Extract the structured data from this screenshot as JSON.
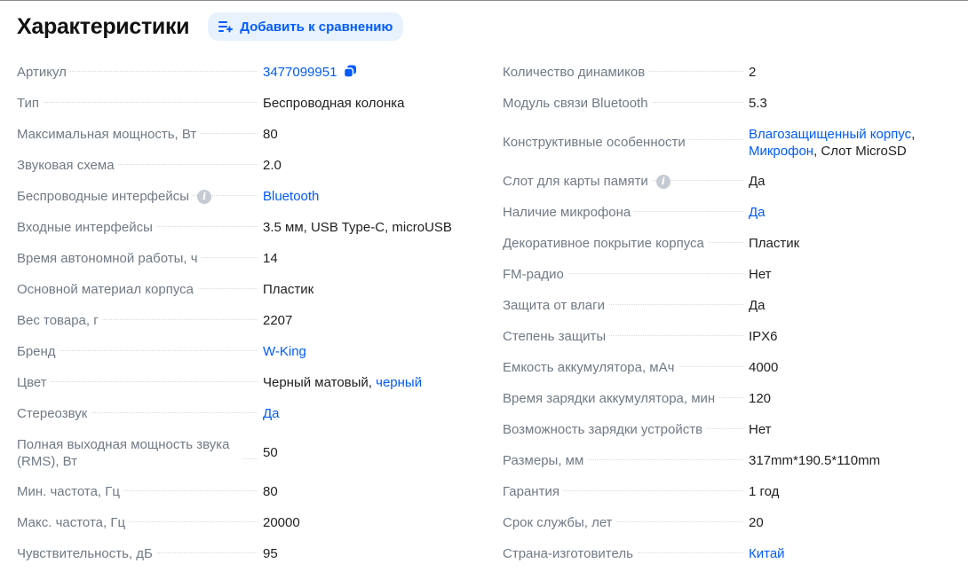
{
  "header": {
    "title": "Характеристики",
    "compare_label": "Добавить к сравнению"
  },
  "colors": {
    "accent": "#005bff",
    "label": "#707a85",
    "button_bg": "#e8f2fd"
  },
  "left": [
    {
      "label": "Артикул",
      "parts": [
        {
          "text": "3477099951",
          "link": true
        }
      ],
      "copy": true
    },
    {
      "label": "Тип",
      "parts": [
        {
          "text": "Беспроводная колонка"
        }
      ]
    },
    {
      "label": "Максимальная мощность, Вт",
      "parts": [
        {
          "text": "80"
        }
      ]
    },
    {
      "label": "Звуковая схема",
      "parts": [
        {
          "text": "2.0"
        }
      ]
    },
    {
      "label": "Беспроводные интерфейсы",
      "info": true,
      "parts": [
        {
          "text": "Bluetooth",
          "link": true
        }
      ]
    },
    {
      "label": "Входные интерфейсы",
      "parts": [
        {
          "text": "3.5 мм, USB Type-C, microUSB"
        }
      ]
    },
    {
      "label": "Время автономной работы, ч",
      "parts": [
        {
          "text": "14"
        }
      ]
    },
    {
      "label": "Основной материал корпуса",
      "parts": [
        {
          "text": "Пластик"
        }
      ]
    },
    {
      "label": "Вес товара, г",
      "parts": [
        {
          "text": "2207"
        }
      ]
    },
    {
      "label": "Бренд",
      "parts": [
        {
          "text": "W-King",
          "link": true
        }
      ]
    },
    {
      "label": "Цвет",
      "parts": [
        {
          "text": "Черный матовый, "
        },
        {
          "text": "черный",
          "link": true
        }
      ]
    },
    {
      "label": "Стереозвук",
      "parts": [
        {
          "text": "Да",
          "link": true
        }
      ]
    },
    {
      "label": "Полная выходная мощность звука (RMS), Вт",
      "tall": true,
      "parts": [
        {
          "text": "50"
        }
      ]
    },
    {
      "label": "Мин. частота, Гц",
      "parts": [
        {
          "text": "80"
        }
      ]
    },
    {
      "label": "Макс. частота, Гц",
      "parts": [
        {
          "text": "20000"
        }
      ]
    },
    {
      "label": "Чувствительность, дБ",
      "parts": [
        {
          "text": "95"
        }
      ]
    }
  ],
  "right": [
    {
      "label": "Количество динамиков",
      "parts": [
        {
          "text": "2"
        }
      ]
    },
    {
      "label": "Модуль связи Bluetooth",
      "parts": [
        {
          "text": "5.3"
        }
      ]
    },
    {
      "label": "Конструктивные особенности",
      "tall": true,
      "parts": [
        {
          "text": "Влагозащищенный корпус",
          "link": true
        },
        {
          "text": ", "
        },
        {
          "text": "Микрофон",
          "link": true
        },
        {
          "text": ", Слот MicroSD"
        }
      ]
    },
    {
      "label": "Слот для карты памяти",
      "info": true,
      "parts": [
        {
          "text": "Да"
        }
      ]
    },
    {
      "label": "Наличие микрофона",
      "parts": [
        {
          "text": "Да",
          "link": true
        }
      ]
    },
    {
      "label": "Декоративное покрытие корпуса",
      "parts": [
        {
          "text": "Пластик"
        }
      ]
    },
    {
      "label": "FM-радио",
      "parts": [
        {
          "text": "Нет"
        }
      ]
    },
    {
      "label": "Защита от влаги",
      "parts": [
        {
          "text": "Да"
        }
      ]
    },
    {
      "label": "Степень защиты",
      "parts": [
        {
          "text": "IPX6"
        }
      ]
    },
    {
      "label": "Емкость аккумулятора, мАч",
      "parts": [
        {
          "text": "4000"
        }
      ]
    },
    {
      "label": "Время зарядки аккумулятора, мин",
      "parts": [
        {
          "text": "120"
        }
      ]
    },
    {
      "label": "Возможность зарядки устройств",
      "parts": [
        {
          "text": "Нет"
        }
      ]
    },
    {
      "label": "Размеры, мм",
      "parts": [
        {
          "text": "317mm*190.5*110mm"
        }
      ]
    },
    {
      "label": "Гарантия",
      "parts": [
        {
          "text": "1 год"
        }
      ]
    },
    {
      "label": "Срок службы, лет",
      "parts": [
        {
          "text": "20"
        }
      ]
    },
    {
      "label": "Страна-изготовитель",
      "parts": [
        {
          "text": "Китай",
          "link": true
        }
      ]
    }
  ]
}
